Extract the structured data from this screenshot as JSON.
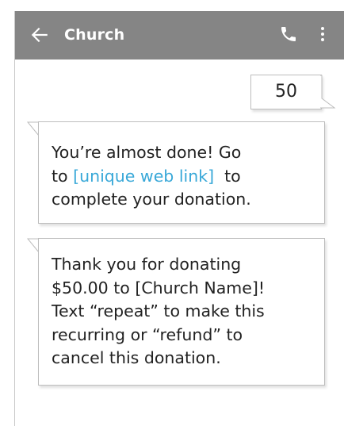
{
  "appbar": {
    "title": "Church",
    "back_icon": "arrow-left-icon",
    "call_icon": "phone-icon",
    "menu_icon": "more-vertical-icon",
    "background": "#858585"
  },
  "messages": {
    "sent_1": {
      "text": "50"
    },
    "received_1": {
      "line1": "You’re almost done! Go",
      "line2_prefix": "to ",
      "link": "[unique web link]",
      "line2_suffix": "  to",
      "line3": "complete your donation.",
      "link_color": "#38a8d8"
    },
    "received_2": {
      "lines": [
        "Thank you for donating",
        "$50.00 to [Church Name]!",
        "Text “repeat” to make this",
        "recurring or “refund” to",
        "cancel this donation."
      ]
    }
  }
}
